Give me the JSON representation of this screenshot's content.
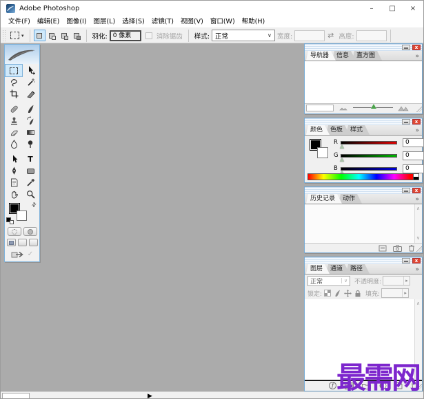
{
  "window": {
    "title": "Adobe Photoshop"
  },
  "window_controls": {
    "minimize": "–",
    "maximize": "□",
    "close": "×"
  },
  "menu": {
    "items": [
      "文件(F)",
      "编辑(E)",
      "图像(I)",
      "图层(L)",
      "选择(S)",
      "滤镜(T)",
      "视图(V)",
      "窗口(W)",
      "帮助(H)"
    ]
  },
  "options_bar": {
    "feather_label": "羽化:",
    "feather_value": "0 像素",
    "antialias_label": "消除锯齿",
    "style_label": "样式:",
    "style_value": "正常",
    "width_label": "宽度:",
    "width_value": "",
    "height_label": "高度:",
    "height_value": ""
  },
  "toolbox": {
    "tools": [
      "rectangular-marquee",
      "move",
      "lasso",
      "magic-wand",
      "crop",
      "slice",
      "healing-brush",
      "brush",
      "clone-stamp",
      "history-brush",
      "eraser",
      "gradient",
      "blur",
      "dodge",
      "path-selection",
      "type",
      "pen",
      "shape",
      "notes",
      "eyedropper",
      "hand",
      "zoom"
    ],
    "selected_tool": "rectangular-marquee"
  },
  "panels": {
    "navigator": {
      "tabs": [
        "导航器",
        "信息",
        "直方图"
      ],
      "active_tab": "导航器"
    },
    "color": {
      "tabs": [
        "颜色",
        "色板",
        "样式"
      ],
      "active_tab": "颜色",
      "channels": [
        {
          "label": "R",
          "value": "0"
        },
        {
          "label": "G",
          "value": "0"
        },
        {
          "label": "B",
          "value": "0"
        }
      ]
    },
    "history": {
      "tabs": [
        "历史记录",
        "动作"
      ],
      "active_tab": "历史记录"
    },
    "layers": {
      "tabs": [
        "图层",
        "通道",
        "路径"
      ],
      "active_tab": "图层",
      "blend_mode": "正常",
      "opacity_label": "不透明度:",
      "opacity_value": "",
      "lock_label": "锁定:",
      "fill_label": "填充:",
      "fill_value": ""
    }
  },
  "status_bar": {
    "zoom_value": ""
  },
  "watermark": {
    "text": "最需网",
    "color": "#7d26cd"
  },
  "icons": {
    "panel_more": "»",
    "combo_chevron": "∨",
    "dropdown_caret": "▾",
    "swap": "⇄",
    "field_arrow": "▸",
    "status_arrow": "▶",
    "scroll_up": "∧",
    "scroll_down": "∨",
    "check": "✓",
    "type_glyph": "T"
  },
  "colors": {
    "workspace": "#ababab",
    "panel_border": "#74a9d4",
    "selection_highlight": "#cfe9fb",
    "close_button": "#df4734",
    "watermark": "#7d26cd"
  }
}
